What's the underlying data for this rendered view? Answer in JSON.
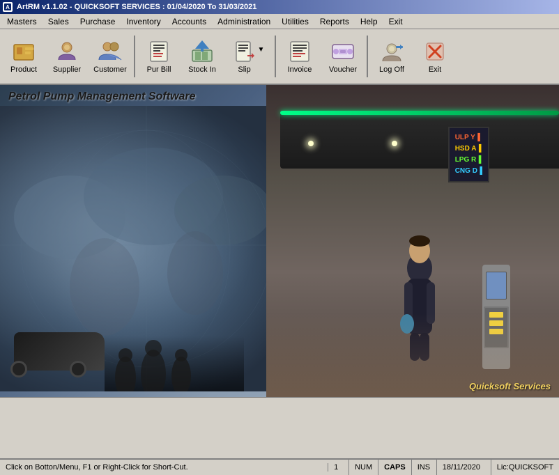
{
  "titlebar": {
    "icon": "A",
    "text": "ArtRM v1.1.02 - QUICKSOFT SERVICES : 01/04/2020 To 31/03/2021"
  },
  "menu": {
    "items": [
      {
        "id": "masters",
        "label": "Masters"
      },
      {
        "id": "sales",
        "label": "Sales"
      },
      {
        "id": "purchase",
        "label": "Purchase"
      },
      {
        "id": "inventory",
        "label": "Inventory"
      },
      {
        "id": "accounts",
        "label": "Accounts"
      },
      {
        "id": "administration",
        "label": "Administration"
      },
      {
        "id": "utilities",
        "label": "Utilities"
      },
      {
        "id": "reports",
        "label": "Reports"
      },
      {
        "id": "help",
        "label": "Help"
      },
      {
        "id": "exit",
        "label": "Exit"
      }
    ]
  },
  "toolbar": {
    "buttons": [
      {
        "id": "product",
        "label": "Product",
        "icon": "product-icon"
      },
      {
        "id": "supplier",
        "label": "Supplier",
        "icon": "supplier-icon"
      },
      {
        "id": "customer",
        "label": "Customer",
        "icon": "customer-icon"
      },
      {
        "id": "purbill",
        "label": "Pur Bill",
        "icon": "purbill-icon"
      },
      {
        "id": "stockin",
        "label": "Stock In",
        "icon": "stockin-icon"
      },
      {
        "id": "slip",
        "label": "Slip",
        "icon": "slip-icon",
        "hasArrow": true
      },
      {
        "id": "invoice",
        "label": "Invoice",
        "icon": "invoice-icon"
      },
      {
        "id": "voucher",
        "label": "Voucher",
        "icon": "voucher-icon"
      },
      {
        "id": "logout",
        "label": "Log Off",
        "icon": "logout-icon"
      },
      {
        "id": "exit",
        "label": "Exit",
        "icon": "exit-icon"
      }
    ]
  },
  "banner": {
    "title": "Petrol Pump Management Software",
    "fuel_types": [
      "ULP",
      "HSD",
      "LPG",
      "CNG"
    ],
    "watermark": "Quicksoft Services"
  },
  "statusbar": {
    "message": "Click on Botton/Menu, F1 or Right-Click for Short-Cut.",
    "page": "1",
    "num": "NUM",
    "caps": "CAPS",
    "ins": "INS",
    "date": "18/11/2020",
    "license": "Lic:QUICKSOFT"
  }
}
